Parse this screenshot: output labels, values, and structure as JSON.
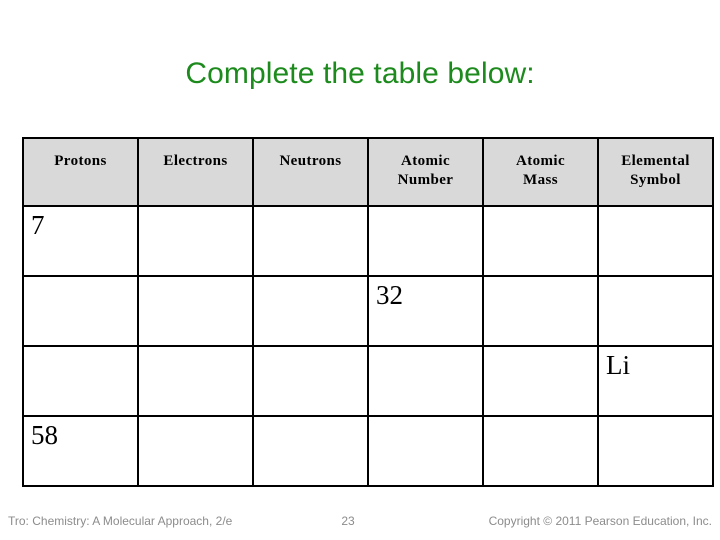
{
  "slide": {
    "title": "Complete the table below:",
    "title_color": "#1c8a1c"
  },
  "table": {
    "header_background": "#d9d9d9",
    "border_color": "#000000",
    "columns": [
      {
        "line1": "Protons",
        "line2": ""
      },
      {
        "line1": "Electrons",
        "line2": ""
      },
      {
        "line1": "Neutrons",
        "line2": ""
      },
      {
        "line1": "Atomic",
        "line2": "Number"
      },
      {
        "line1": "Atomic",
        "line2": "Mass"
      },
      {
        "line1": "Elemental",
        "line2": "Symbol"
      }
    ],
    "rows": [
      {
        "cells": [
          "7",
          "",
          "",
          "",
          "",
          ""
        ]
      },
      {
        "cells": [
          "",
          "",
          "",
          "32",
          "",
          ""
        ]
      },
      {
        "cells": [
          "",
          "",
          "",
          "",
          "",
          "Li"
        ]
      },
      {
        "cells": [
          "58",
          "",
          "",
          "",
          "",
          ""
        ]
      }
    ]
  },
  "footer": {
    "source": "Tro: Chemistry: A Molecular Approach, 2/e",
    "page_number": "23",
    "copyright": "Copyright © 2011 Pearson Education, Inc.",
    "text_color": "#8c8c8c"
  }
}
